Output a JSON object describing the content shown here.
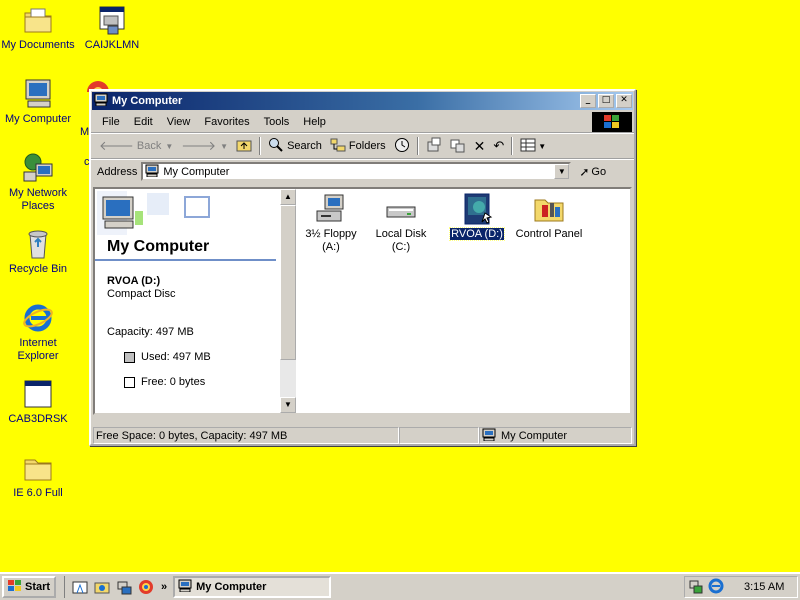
{
  "desktop": {
    "icons": [
      {
        "label": "My Documents"
      },
      {
        "label": "CAIJKLMN"
      },
      {
        "label": "My Computer"
      },
      {
        "label": "My Network Places"
      },
      {
        "label": "Recycle Bin"
      },
      {
        "label": "Internet Explorer"
      },
      {
        "label": "CAB3DRSK"
      },
      {
        "label": "IE 6.0 Full"
      }
    ],
    "partial_labels": [
      "M",
      "c"
    ]
  },
  "window": {
    "title": "My Computer",
    "menu": [
      "File",
      "Edit",
      "View",
      "Favorites",
      "Tools",
      "Help"
    ],
    "toolbar": {
      "back": "Back",
      "search": "Search",
      "folders": "Folders"
    },
    "address": {
      "label": "Address",
      "value": "My Computer",
      "go": "Go"
    },
    "left_pane": {
      "title": "My Computer",
      "drive_name": "RVOA (D:)",
      "drive_type": "Compact Disc",
      "capacity": "Capacity: 497 MB",
      "used": "Used: 497 MB",
      "free": "Free: 0 bytes"
    },
    "items": [
      {
        "label": "3½ Floppy (A:)",
        "icon": "floppy-drive-icon"
      },
      {
        "label": "Local Disk (C:)",
        "icon": "hard-disk-icon"
      },
      {
        "label": "RVOA (D:)",
        "icon": "cd-drive-icon",
        "selected": true
      },
      {
        "label": "Control Panel",
        "icon": "control-panel-icon"
      }
    ],
    "status": {
      "info": "Free Space: 0 bytes, Capacity: 497 MB",
      "zone": "My Computer"
    }
  },
  "taskbar": {
    "start": "Start",
    "task": "My Computer",
    "clock": "3:15 AM",
    "chevron": "»"
  },
  "colors": {
    "desktop": "#ffff00",
    "title_active": "#0a246a",
    "selection": "#0a246a"
  }
}
